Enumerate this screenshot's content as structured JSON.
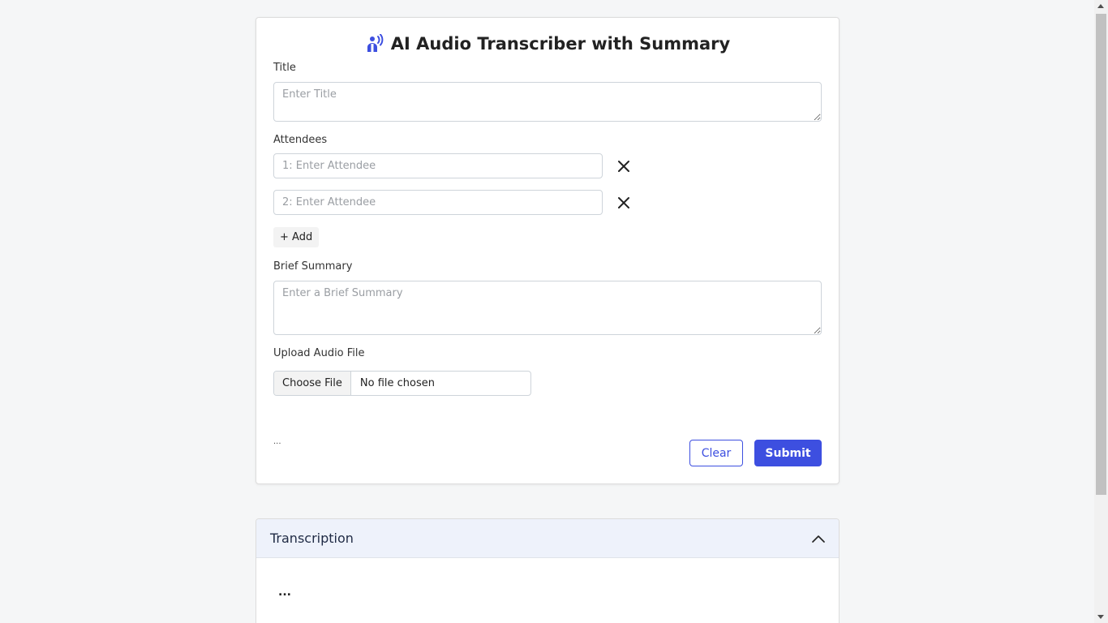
{
  "header": {
    "title": "AI Audio Transcriber with Summary",
    "icon": "podcast-icon",
    "accent": "#3d4fe0"
  },
  "form": {
    "title_label": "Title",
    "title_placeholder": "Enter Title",
    "attendees_label": "Attendees",
    "attendees": [
      {
        "placeholder": "1: Enter Attendee"
      },
      {
        "placeholder": "2: Enter Attendee"
      }
    ],
    "add_label": "+ Add",
    "summary_label": "Brief Summary",
    "summary_placeholder": "Enter a Brief Summary",
    "upload_label": "Upload Audio File",
    "file_button": "Choose File",
    "file_status": "No file chosen",
    "status_text": "...",
    "clear_label": "Clear",
    "submit_label": "Submit"
  },
  "transcription": {
    "title": "Transcription",
    "content": "..."
  }
}
